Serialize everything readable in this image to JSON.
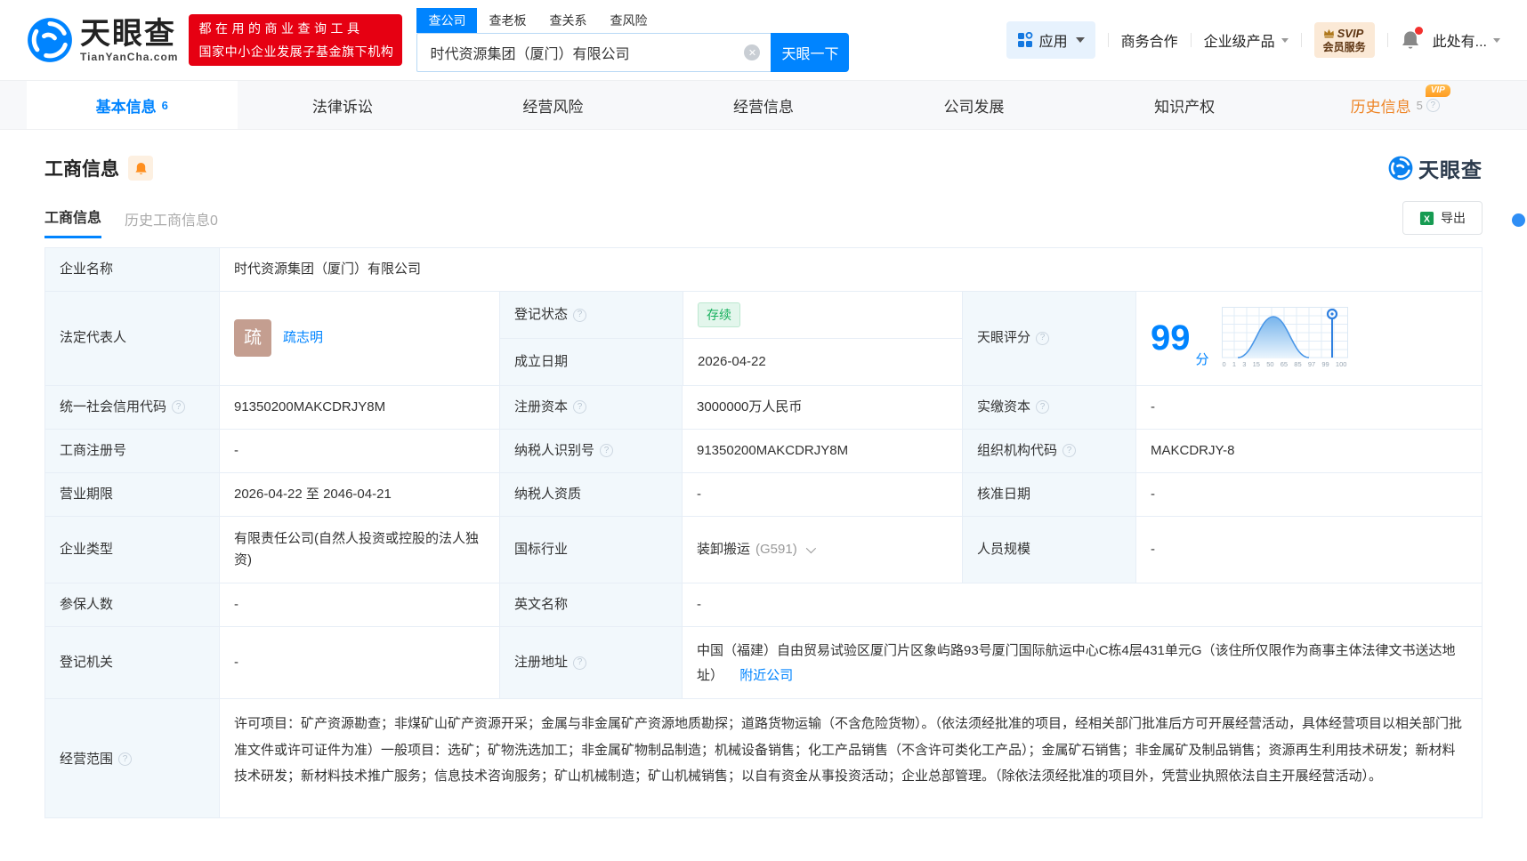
{
  "brand": {
    "name": "天眼查",
    "domain": "TianYanCha.com"
  },
  "colors": {
    "brand_blue": "#0084ff",
    "promo_red": "#e60012",
    "vip_orange": "#ff9d22",
    "status_green": "#16b05c"
  },
  "header": {
    "promo_line1": "都在用的商业查询工具",
    "promo_line2": "国家中小企业发展子基金旗下机构",
    "search_tabs": [
      {
        "label": "查公司"
      },
      {
        "label": "查老板"
      },
      {
        "label": "查关系"
      },
      {
        "label": "查风险"
      }
    ],
    "search_value": "时代资源集团（厦门）有限公司",
    "search_button": "天眼一下",
    "apps_label": "应用",
    "link_cooperation": "商务合作",
    "link_enterprise": "企业级产品",
    "svip_line1": "SVIP",
    "svip_line2": "会员服务",
    "user_label": "此处有..."
  },
  "nav_tabs": [
    {
      "label": "基本信息",
      "count": "6"
    },
    {
      "label": "法律诉讼",
      "count": ""
    },
    {
      "label": "经营风险",
      "count": ""
    },
    {
      "label": "经营信息",
      "count": ""
    },
    {
      "label": "公司发展",
      "count": ""
    },
    {
      "label": "知识产权",
      "count": ""
    },
    {
      "label": "历史信息",
      "count": "5",
      "badge": "VIP"
    }
  ],
  "section": {
    "title": "工商信息",
    "watermark": "天眼查",
    "subtab_active": "工商信息",
    "subtab_history": "历史工商信息0",
    "export_label": "导出"
  },
  "table": {
    "company_name_label": "企业名称",
    "company_name": "时代资源集团（厦门）有限公司",
    "legal_rep_label": "法定代表人",
    "legal_rep_avatar": "疏",
    "legal_rep_name": "疏志明",
    "reg_status_label": "登记状态",
    "reg_status_value": "存续",
    "est_date_label": "成立日期",
    "est_date_value": "2026-04-22",
    "score_label": "天眼评分",
    "credit_code_label": "统一社会信用代码",
    "credit_code_value": "91350200MAKCDRJY8M",
    "reg_capital_label": "注册资本",
    "reg_capital_value": "3000000万人民币",
    "paid_capital_label": "实缴资本",
    "paid_capital_value": "-",
    "reg_no_label": "工商注册号",
    "reg_no_value": "-",
    "taxpayer_id_label": "纳税人识别号",
    "taxpayer_id_value": "91350200MAKCDRJY8M",
    "org_code_label": "组织机构代码",
    "org_code_value": "MAKCDRJY-8",
    "term_label": "营业期限",
    "term_value": "2026-04-22 至 2046-04-21",
    "taxpayer_quality_label": "纳税人资质",
    "taxpayer_quality_value": "-",
    "approval_date_label": "核准日期",
    "approval_date_value": "-",
    "company_type_label": "企业类型",
    "company_type_value": "有限责任公司(自然人投资或控股的法人独资)",
    "industry_label": "国标行业",
    "industry_value": "装卸搬运",
    "industry_code": "(G591)",
    "staff_size_label": "人员规模",
    "staff_size_value": "-",
    "insured_label": "参保人数",
    "insured_value": "-",
    "english_name_label": "英文名称",
    "english_name_value": "-",
    "reg_authority_label": "登记机关",
    "reg_authority_value": "-",
    "address_label": "注册地址",
    "address_value": "中国（福建）自由贸易试验区厦门片区象屿路93号厦门国际航运中心C栋4层431单元G（该住所仅限作为商事主体法律文书送达地址）",
    "address_link": "附近公司",
    "scope_label": "经营范围",
    "scope_value": "许可项目：矿产资源勘查；非煤矿山矿产资源开采；金属与非金属矿产资源地质勘探；道路货物运输（不含危险货物）。（依法须经批准的项目，经相关部门批准后方可开展经营活动，具体经营项目以相关部门批准文件或许可证件为准）一般项目：选矿；矿物洗选加工；非金属矿物制品制造；机械设备销售；化工产品销售（不含许可类化工产品）；金属矿石销售；非金属矿及制品销售；资源再生利用技术研发；新材料技术研发；新材料技术推广服务；信息技术咨询服务；矿山机械制造；矿山机械销售；以自有资金从事投资活动；企业总部管理。（除依法须经批准的项目外，凭营业执照依法自主开展经营活动）。"
  },
  "chart_data": {
    "type": "area",
    "title": "天眼评分分布曲线",
    "score": "99",
    "score_unit": "分",
    "xlim": [
      0,
      100
    ],
    "x_ticks": [
      "0",
      "1",
      "3",
      "15",
      "50",
      "65",
      "85",
      "97",
      "99",
      "100"
    ],
    "marker_x": 99,
    "curve_profile_pct": [
      [
        15,
        0
      ],
      [
        28,
        3
      ],
      [
        38,
        30
      ],
      [
        46,
        78
      ],
      [
        52,
        100
      ],
      [
        58,
        88
      ],
      [
        66,
        38
      ],
      [
        74,
        10
      ],
      [
        82,
        2
      ],
      [
        90,
        0
      ]
    ],
    "grid": true,
    "curve_color": "#4a97e8"
  }
}
